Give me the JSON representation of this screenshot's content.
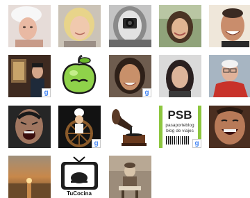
{
  "followers": [
    {
      "id": "follower-1",
      "bg": "#e9dfdc",
      "desc": "woman with white chef hat"
    },
    {
      "id": "follower-2",
      "bg": "#c9c2b8",
      "desc": "smiling blonde woman"
    },
    {
      "id": "follower-3",
      "bg": "#bdbdbd",
      "desc": "person holding camera, black and white"
    },
    {
      "id": "follower-4",
      "bg": "#9fb08a",
      "desc": "woman with dark hair in green setting"
    },
    {
      "id": "follower-5",
      "bg": "#ece4d6",
      "desc": "man laughing, light background"
    },
    {
      "id": "follower-6",
      "bg": "#4a3226",
      "desc": "man in dark room"
    },
    {
      "id": "follower-7",
      "bg": "#ffffff",
      "desc": "green apple cartoon with mustache"
    },
    {
      "id": "follower-8",
      "bg": "#7d6a5a",
      "desc": "smiling woman with dark hair"
    },
    {
      "id": "follower-9",
      "bg": "#d8d8d8",
      "desc": "woman with long dark hair"
    },
    {
      "id": "follower-10",
      "bg": "#a8b4c0",
      "desc": "older man with glasses, red jacket"
    },
    {
      "id": "follower-11",
      "bg": "#2c2c2c",
      "desc": "man shouting, dark background"
    },
    {
      "id": "follower-12",
      "bg": "#151515",
      "desc": "cartoon chef at ship wheel"
    },
    {
      "id": "follower-13",
      "bg": "#ffffff",
      "desc": "vintage gramophone"
    },
    {
      "id": "follower-14",
      "bg": "#ffffff",
      "desc": "PSB pasaporteblog logo"
    },
    {
      "id": "follower-15",
      "bg": "#5a3a2a",
      "desc": "man laughing close-up"
    },
    {
      "id": "follower-16",
      "bg": "#8a6a45",
      "desc": "sunset over sea"
    },
    {
      "id": "follower-17",
      "bg": "#ffffff",
      "desc": "retro TV with turkey, TuCocina"
    },
    {
      "id": "follower-18",
      "bg": "#9a8a78",
      "desc": "child in vintage sepia photo"
    }
  ],
  "badge_glyph": "g",
  "psb": {
    "title": "PSB",
    "line1": "pasaporteblog",
    "line2": "blog de viajes"
  },
  "tucocina": "TuCocina"
}
